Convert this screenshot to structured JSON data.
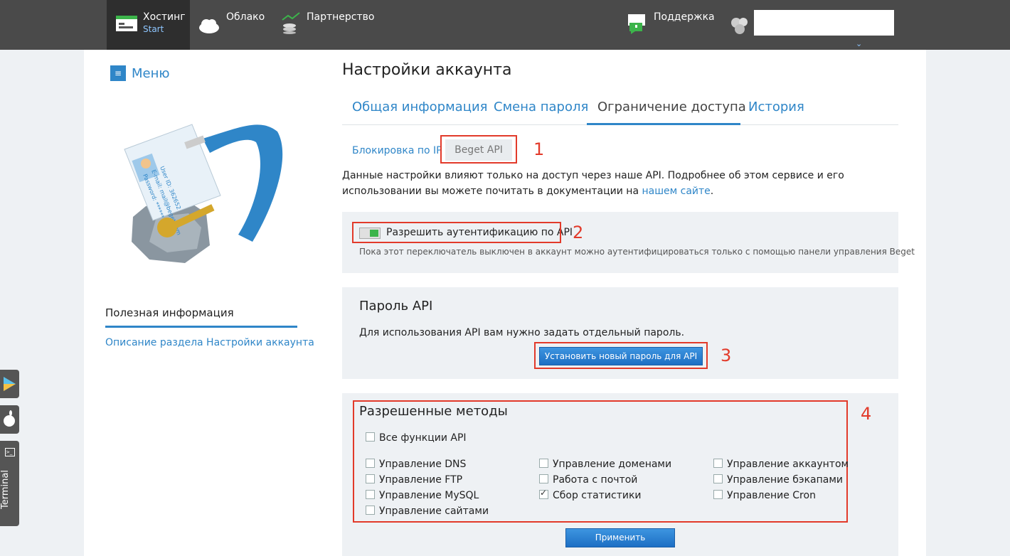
{
  "topnav": {
    "hosting": {
      "label": "Хостинг",
      "sub": "Start"
    },
    "cloud": "Облако",
    "partnership": "Партнерство",
    "support": "Поддержка"
  },
  "menu_label": "Меню",
  "page_title": "Настройки аккаунта",
  "tabs": [
    "Общая информация",
    "Смена пароля",
    "Ограничение доступа",
    "История"
  ],
  "subtabs": {
    "ip": "Блокировка по IP",
    "api": "Beget API"
  },
  "intro": {
    "text": "Данные настройки влияют только на доступ через наше API. Подробнее об этом сервисе и его использовании вы можете почитать в документации на",
    "link": "нашем сайте",
    "end": "."
  },
  "auth": {
    "toggle_label": "Разрешить аутентификацию по API",
    "note": "Пока этот переключатель выключен в аккаунт можно аутентифицироваться только с помощью панели управления Beget",
    "enabled": true
  },
  "password": {
    "title": "Пароль API",
    "text": "Для использования API вам нужно задать отдельный пароль.",
    "button": "Установить новый пароль для API"
  },
  "methods": {
    "title": "Разрешенные методы",
    "all": "Все функции API",
    "col1": [
      "Управление DNS",
      "Управление FTP",
      "Управление MySQL",
      "Управление сайтами"
    ],
    "col2": [
      "Управление доменами",
      "Работа с почтой",
      "Сбор статистики"
    ],
    "col3": [
      "Управление аккаунтом",
      "Управление бэкапами",
      "Управление Cron"
    ],
    "apply": "Применить"
  },
  "sidebar": {
    "useful_title": "Полезная информация",
    "useful_link": "Описание раздела Настройки аккаунта"
  },
  "badge": {
    "user_id": "User ID: 362652",
    "email": "E-mail: mail@beget.com",
    "password": "Password: ******"
  },
  "annotations": [
    "1",
    "2",
    "3",
    "4"
  ],
  "side_tabs": {
    "terminal": "Terminal"
  },
  "colors": {
    "accent": "#2f86c8",
    "annotation": "#e23a2a",
    "toggle_on": "#3cb44b"
  }
}
